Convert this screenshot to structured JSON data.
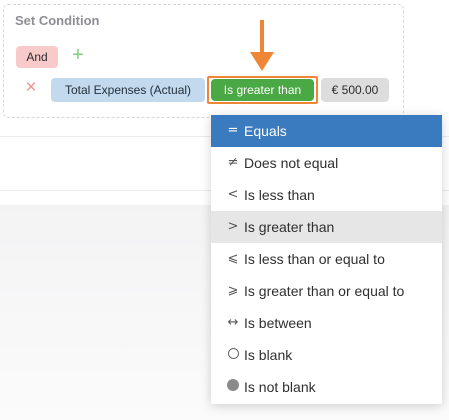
{
  "condition": {
    "title": "Set Condition",
    "logic_label": "And",
    "add_icon": "plus-icon",
    "remove_icon": "close-icon",
    "field": "Total Expenses (Actual)",
    "operator": "Is greater than",
    "value": "€ 500.00"
  },
  "annotation": {
    "arrow_color": "#ee8636",
    "highlight_color": "#ee8636"
  },
  "colors": {
    "logic_chip": "#f8caca",
    "field_chip": "#c3d9ee",
    "operator_chip": "#4aa845",
    "value_chip": "#dddddd",
    "dropdown_selected": "#3a7abf",
    "dropdown_hover": "#e6e6e6"
  },
  "dropdown": {
    "selected_value": "Equals",
    "hovered_value": "Is greater than",
    "items": [
      {
        "symbol": "=",
        "icon": "equals-icon",
        "label": "Equals"
      },
      {
        "symbol": "≠",
        "icon": "not-equal-icon",
        "label": "Does not equal"
      },
      {
        "symbol": "<",
        "icon": "less-than-icon",
        "label": "Is less than"
      },
      {
        "symbol": ">",
        "icon": "greater-than-icon",
        "label": "Is greater than"
      },
      {
        "symbol": "⩽",
        "icon": "less-or-equal-icon",
        "label": "Is less than or equal to"
      },
      {
        "symbol": "⩾",
        "icon": "greater-or-equal-icon",
        "label": "Is greater than or equal to"
      },
      {
        "symbol": "↔",
        "icon": "between-icon",
        "label": "Is between"
      },
      {
        "symbol": "",
        "icon": "blank-circle-icon",
        "label": "Is blank"
      },
      {
        "symbol": "",
        "icon": "filled-circle-icon",
        "label": "Is not blank"
      }
    ]
  }
}
